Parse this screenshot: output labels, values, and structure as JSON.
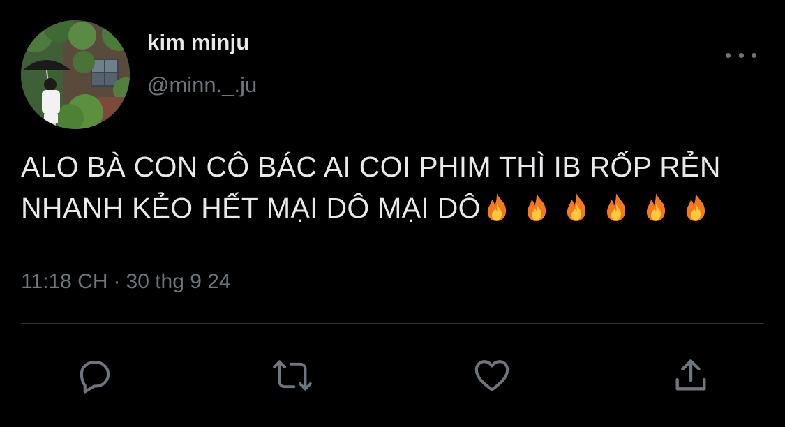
{
  "tweet": {
    "author": {
      "display_name": "kim minju",
      "handle": "@minn._.ju",
      "avatar": "profile-photo-avatar"
    },
    "text_lines": [
      "ALO BÀ CON CÔ BÁC AI COI PHIM THÌ IB RỐP RẺN",
      "NHANH KẺO HẾT MẠI DÔ MẠI DÔ"
    ],
    "emoji": [
      "fire",
      "fire",
      "fire",
      "fire",
      "fire",
      "fire"
    ],
    "time": "11:18 CH",
    "separator": "·",
    "date": "30 thg 9 24"
  },
  "icons": {
    "more": "more-horizontal-icon",
    "reply": "reply-icon",
    "retweet": "retweet-icon",
    "like": "like-icon",
    "share": "share-icon"
  },
  "colors": {
    "background": "#000000",
    "text_primary": "#e7e9ea",
    "text_secondary": "#6e767d",
    "divider": "#2f3336"
  }
}
